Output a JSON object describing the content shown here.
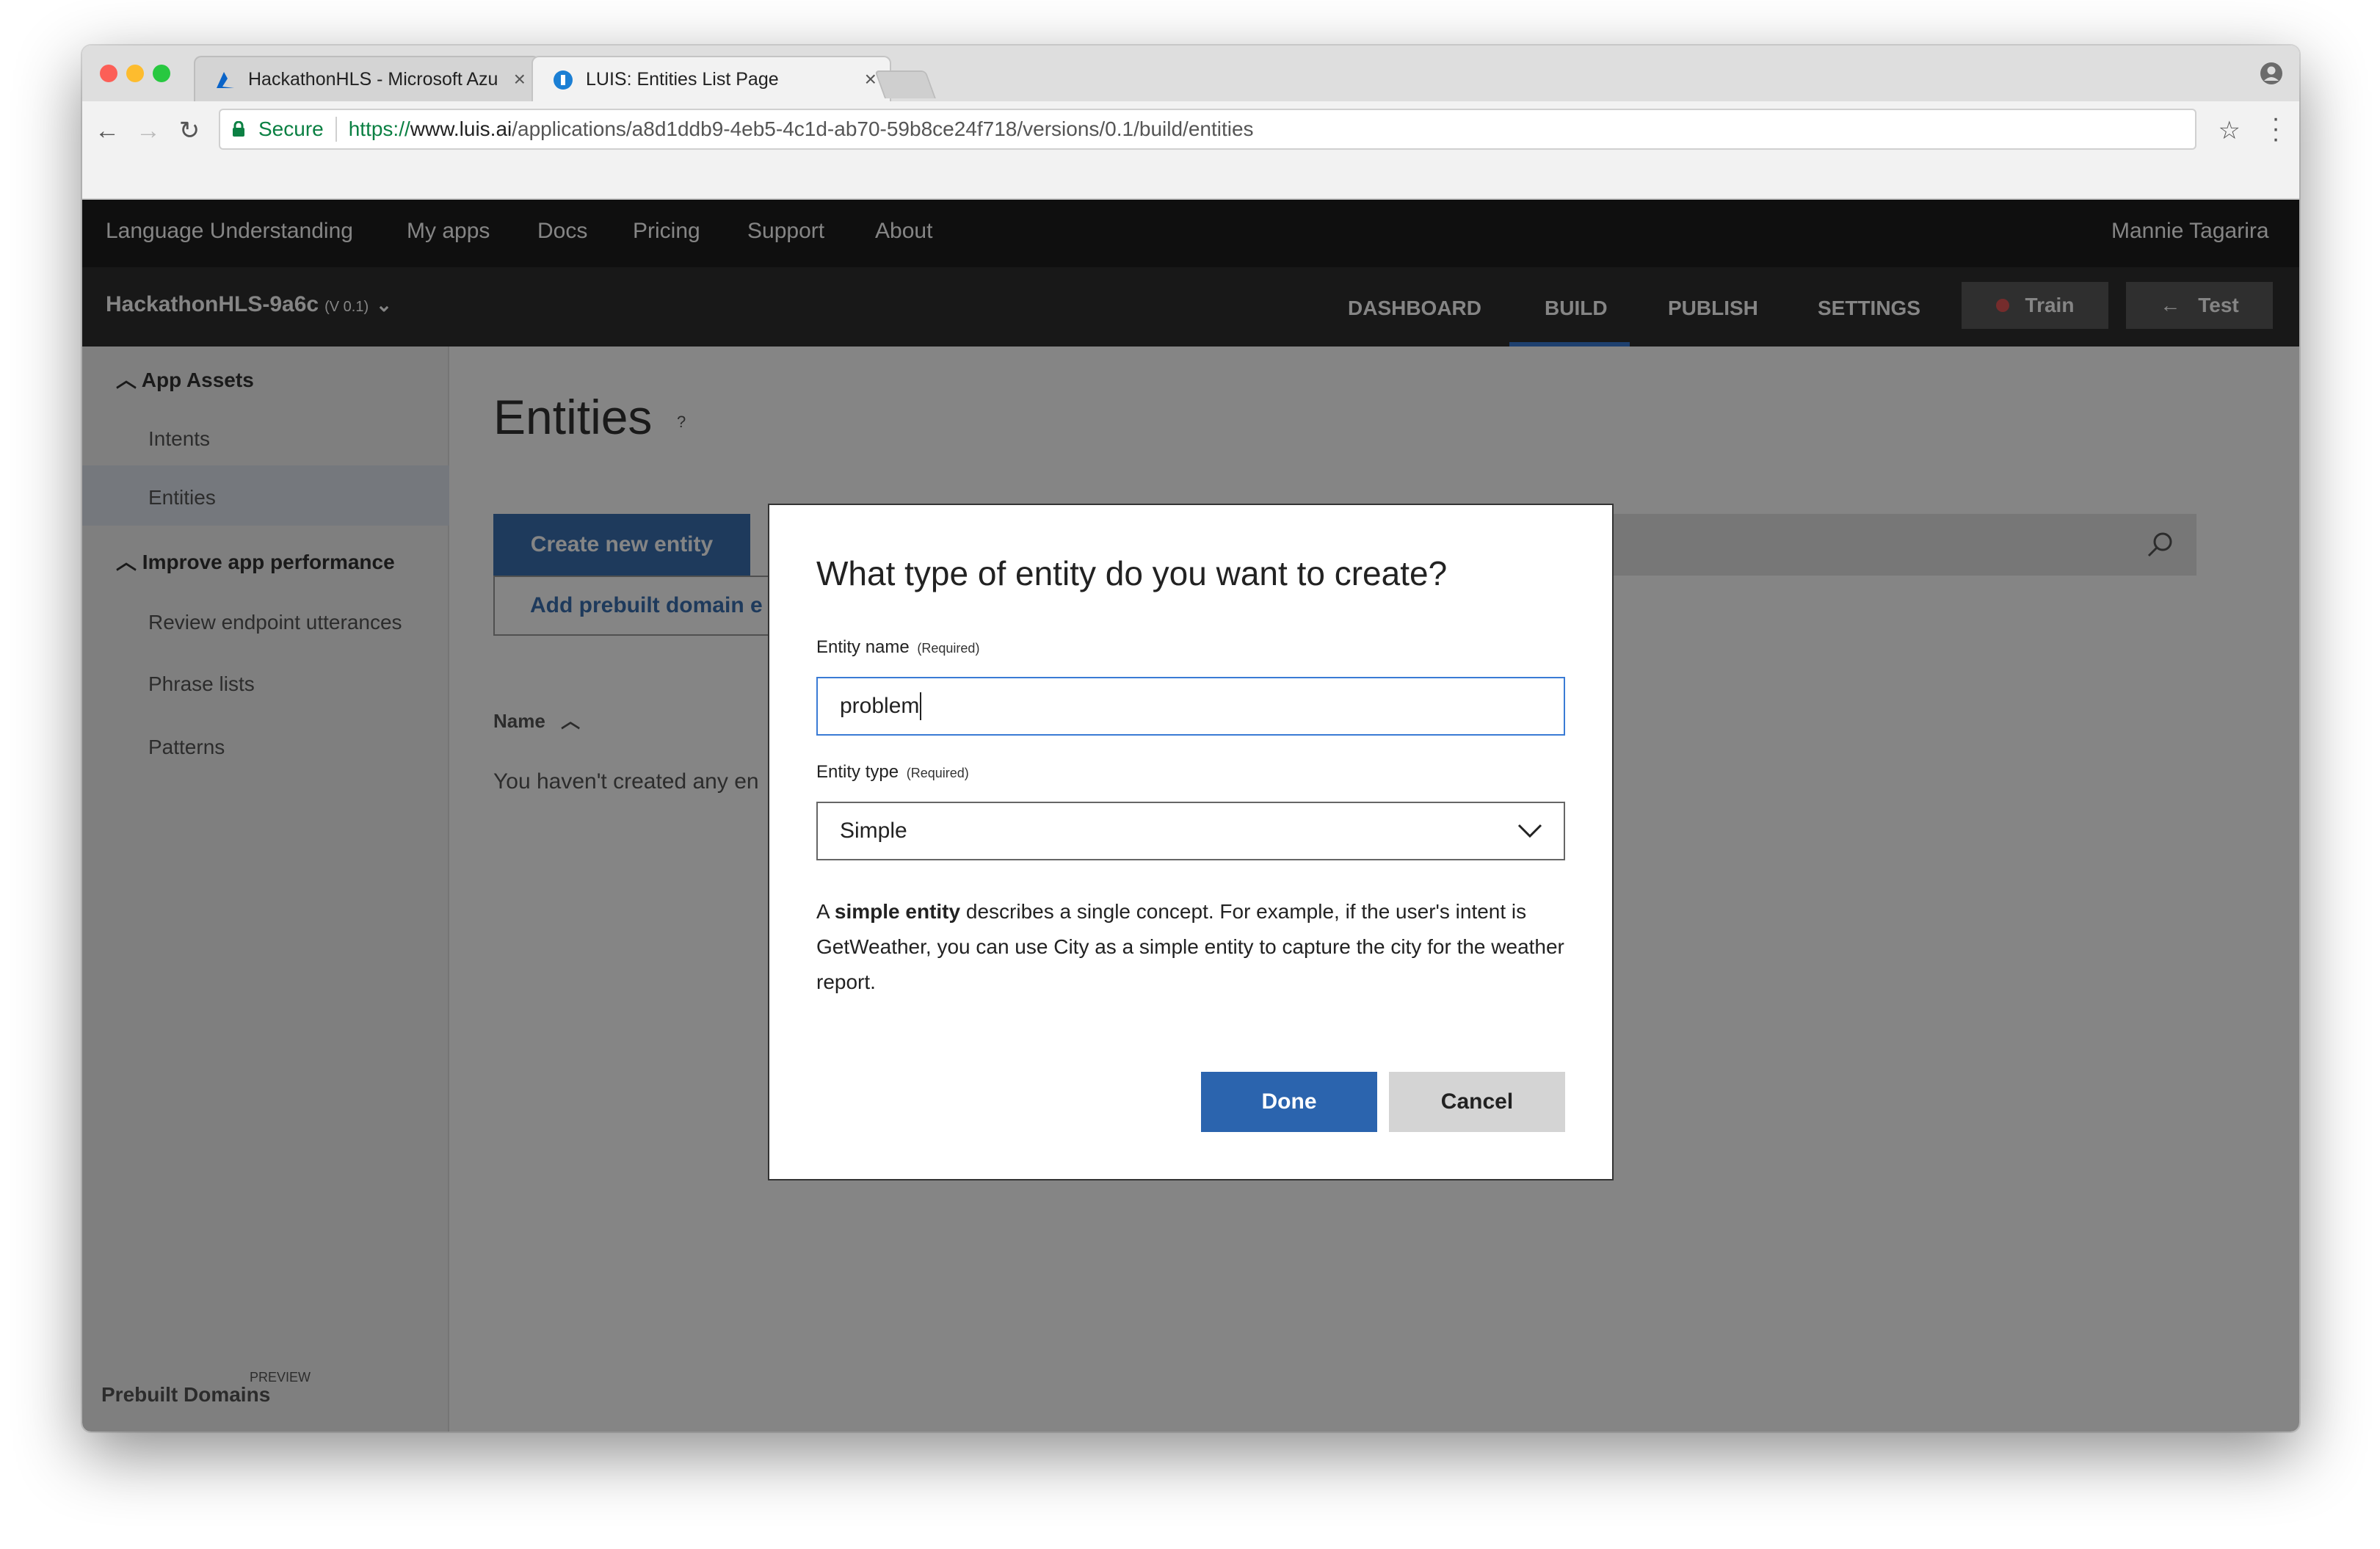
{
  "browser": {
    "tabs": [
      {
        "title": "HackathonHLS - Microsoft Azu",
        "close": "×"
      },
      {
        "title": "LUIS: Entities List Page",
        "close": "×"
      }
    ],
    "secure_label": "Secure",
    "url_scheme": "https://",
    "url_host": "www.luis.ai",
    "url_path": "/applications/a8d1ddb9-4eb5-4c1d-ab70-59b8ce24f718/versions/0.1/build/entities"
  },
  "topnav": {
    "brand": "Language Understanding",
    "items": [
      "My apps",
      "Docs",
      "Pricing",
      "Support",
      "About"
    ],
    "user": "Mannie Tagarira"
  },
  "appbar": {
    "app_name": "HackathonHLS-9a6c",
    "version": "(V 0.1)",
    "tabs": [
      "DASHBOARD",
      "BUILD",
      "PUBLISH",
      "SETTINGS"
    ],
    "train_label": "Train",
    "test_label": "Test"
  },
  "sidebar": {
    "section1": "App Assets",
    "items1": [
      "Intents",
      "Entities"
    ],
    "section2": "Improve app performance",
    "items2": [
      "Review endpoint utterances",
      "Phrase lists",
      "Patterns"
    ],
    "footer": "Prebuilt Domains",
    "footer_tag": "PREVIEW"
  },
  "main": {
    "title": "Entities",
    "help": "?",
    "create_label": "Create new entity",
    "prebuilt_label": "Add prebuilt domain e",
    "column_name": "Name",
    "empty_text": "You haven't created any en"
  },
  "modal": {
    "title": "What type of entity do you want to create?",
    "name_label": "Entity name",
    "name_required": "(Required)",
    "name_value": "problem",
    "type_label": "Entity type",
    "type_required": "(Required)",
    "type_value": "Simple",
    "desc_prefix": "A ",
    "desc_bold": "simple entity",
    "desc_rest": " describes a single concept. For example, if the user's intent is GetWeather, you can use City as a simple entity to capture the city for the weather report.",
    "done_label": "Done",
    "cancel_label": "Cancel"
  },
  "colors": {
    "accent": "#2b64ae",
    "nav_bg": "#1d1d1d",
    "appbar_bg": "#2e2e2e",
    "secure_green": "#0b8043",
    "close_red": "#fc5f57",
    "minimize_yellow": "#fdbc2e",
    "maximize_green": "#28c840"
  }
}
